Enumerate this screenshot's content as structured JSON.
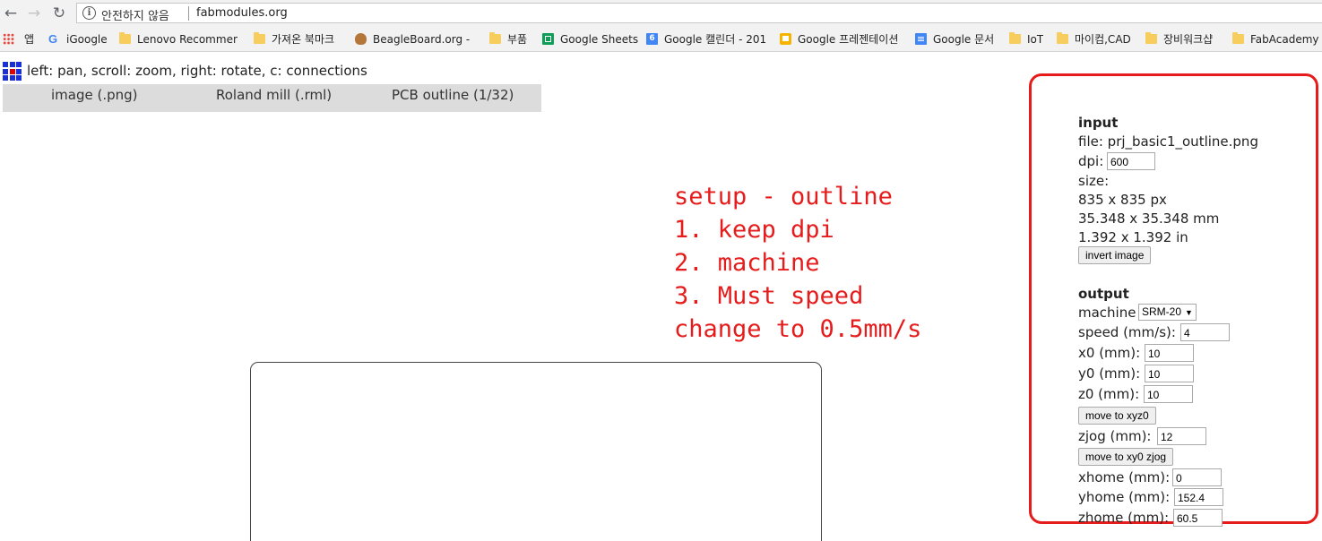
{
  "browser": {
    "security_label": "안전하지 않음",
    "url": "fabmodules.org"
  },
  "bookmarks": [
    {
      "label": "앱",
      "icon": "apps-grid-icon"
    },
    {
      "label": "iGoogle",
      "icon": "google-icon"
    },
    {
      "label": "Lenovo Recommend",
      "icon": "folder-icon"
    },
    {
      "label": "가져온 북마크",
      "icon": "folder-icon"
    },
    {
      "label": "BeagleBoard.org - Be",
      "icon": "beagle-icon"
    },
    {
      "label": "부품",
      "icon": "folder-icon"
    },
    {
      "label": "Google Sheets",
      "icon": "sheets-icon"
    },
    {
      "label": "Google 캘린더 - 201",
      "icon": "calendar-icon",
      "badge": "6"
    },
    {
      "label": "Google 프레젠테이션",
      "icon": "slides-icon"
    },
    {
      "label": "Google 문서",
      "icon": "docs-icon"
    },
    {
      "label": "IoT",
      "icon": "folder-icon"
    },
    {
      "label": "마이컴,CAD",
      "icon": "folder-icon"
    },
    {
      "label": "장비워크샵",
      "icon": "folder-icon"
    },
    {
      "label": "FabAcademy",
      "icon": "folder-icon"
    }
  ],
  "app": {
    "help_text": "left: pan, scroll: zoom, right: rotate, c: connections",
    "menu": [
      "image (.png)",
      "Roland mill (.rml)",
      "PCB outline (1/32)"
    ]
  },
  "annotation": [
    "setup - outline",
    "1. keep dpi",
    "2. machine",
    "3. Must speed",
    "change to 0.5mm/s"
  ],
  "panel": {
    "input": {
      "title": "input",
      "file": "file: prj_basic1_outline.png",
      "dpi_label": "dpi:",
      "dpi_value": "600",
      "size_label": "size:",
      "size_px": "835 x 835 px",
      "size_mm": "35.348 x 35.348 mm",
      "size_in": "1.392 x 1.392 in",
      "invert_button": "invert image"
    },
    "output": {
      "title": "output",
      "machine_label": "machine",
      "machine_value": "SRM-20",
      "speed_label": "speed (mm/s):",
      "speed_value": "4",
      "x0_label": "x0 (mm):",
      "x0_value": "10",
      "y0_label": "y0 (mm):",
      "y0_value": "10",
      "z0_label": "z0 (mm):",
      "z0_value": "10",
      "move_xyz0_button": "move to xyz0",
      "zjog_label": "zjog (mm):",
      "zjog_value": "12",
      "move_xy0_zjog_button": "move to xy0 zjog",
      "xhome_label": "xhome (mm):",
      "xhome_value": "0",
      "yhome_label": "yhome (mm):",
      "yhome_value": "152.4",
      "zhome_label": "zhome (mm):",
      "zhome_value": "60.5"
    }
  },
  "colors": {
    "annotation_red": "#e61c1c",
    "logo_blue": "#1b2fd6",
    "logo_red": "#e00000",
    "menubar_gray": "#dcdcdc"
  }
}
